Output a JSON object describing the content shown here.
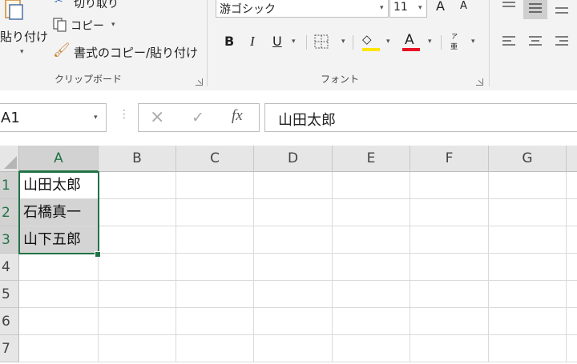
{
  "clipboard": {
    "paste_label": "貼り付け",
    "cut_label": "切り取り",
    "copy_label": "コピー",
    "format_painter_label": "書式のコピー/貼り付け",
    "group_label": "クリップボード"
  },
  "font": {
    "font_name": "游ゴシック",
    "font_size": "11",
    "grow_label": "A",
    "shrink_label": "A",
    "bold": "B",
    "italic": "I",
    "underline": "U",
    "font_color_glyph": "A",
    "phonetic_top": "ア",
    "phonetic_bottom": "亜",
    "group_label": "フォント",
    "fill_color": "#ffe600",
    "font_color": "#e81123"
  },
  "formula_bar": {
    "name_box": "A1",
    "cancel_icon": "×",
    "enter_icon": "✓",
    "fx_label": "fx",
    "content": "山田太郎"
  },
  "grid": {
    "columns": [
      "A",
      "B",
      "C",
      "D",
      "E",
      "F",
      "G"
    ],
    "rows": [
      "1",
      "2",
      "3",
      "4",
      "5",
      "6",
      "7"
    ],
    "cells": {
      "A1": "山田太郎",
      "A2": "石橋真一",
      "A3": "山下五郎"
    },
    "selection": "A1:A3",
    "accent_color": "#217346"
  }
}
